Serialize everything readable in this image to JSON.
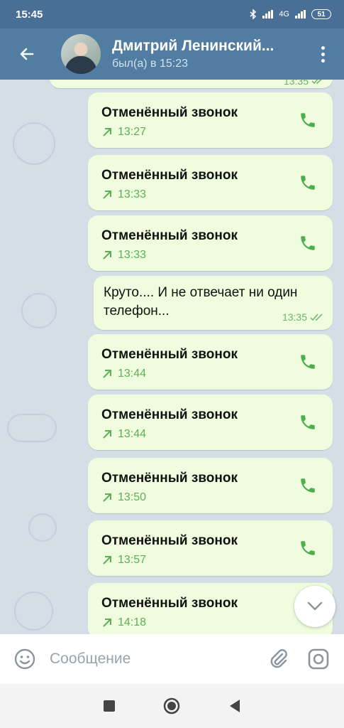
{
  "status_bar": {
    "time": "15:45",
    "network_label": "4G",
    "battery": "51"
  },
  "header": {
    "contact_name": "Дмитрий Ленинский...",
    "last_seen": "был(а) в 15:23"
  },
  "messages": [
    {
      "type": "text",
      "text": "",
      "time": "13:35"
    },
    {
      "type": "call",
      "title": "Отменённый звонок",
      "time": "13:27"
    },
    {
      "type": "call",
      "title": "Отменённый звонок",
      "time": "13:33"
    },
    {
      "type": "call",
      "title": "Отменённый звонок",
      "time": "13:33"
    },
    {
      "type": "text",
      "text": "Круто.... И не отвечает ни один телефон...",
      "time": "13:35"
    },
    {
      "type": "call",
      "title": "Отменённый звонок",
      "time": "13:44"
    },
    {
      "type": "call",
      "title": "Отменённый звонок",
      "time": "13:44"
    },
    {
      "type": "call",
      "title": "Отменённый звонок",
      "time": "13:50"
    },
    {
      "type": "call",
      "title": "Отменённый звонок",
      "time": "13:57"
    },
    {
      "type": "call",
      "title": "Отменённый звонок",
      "time": "14:18"
    }
  ],
  "input": {
    "placeholder": "Сообщение",
    "value": ""
  },
  "icons": {
    "back": "arrow-left-icon",
    "menu": "more-vertical-icon",
    "call": "phone-icon",
    "outgoing": "arrow-up-right-icon",
    "read": "double-check-icon",
    "scroll": "chevron-down-icon",
    "emoji": "smile-icon",
    "attach": "paperclip-icon",
    "camera": "camera-icon"
  },
  "colors": {
    "header": "#517da2",
    "status_bar": "#4a6f96",
    "bubble_out": "#effdde",
    "accent_green": "#5fae5a",
    "chat_bg": "#d5dee6"
  }
}
